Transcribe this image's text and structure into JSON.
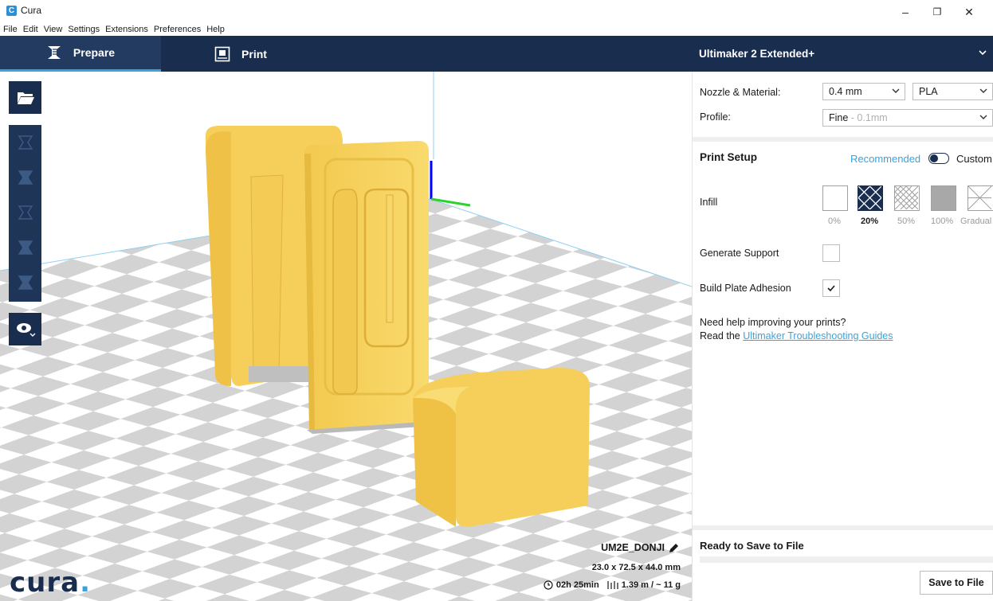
{
  "window": {
    "app_title": "Cura",
    "app_icon_letter": "C",
    "minimize": "–",
    "maximize": "❐",
    "close": "✕"
  },
  "menu": [
    "File",
    "Edit",
    "View",
    "Settings",
    "Extensions",
    "Preferences",
    "Help"
  ],
  "toolbar": {
    "tabs": [
      {
        "label": "Prepare",
        "icon": "layers-icon",
        "active": true
      },
      {
        "label": "Print",
        "icon": "monitor-icon",
        "active": false
      }
    ],
    "machine_name": "Ultimaker 2 Extended+"
  },
  "left_tools": [
    "open-file-icon",
    "move-icon",
    "scale-icon",
    "rotate-icon",
    "mirror-icon",
    "per-model-settings-icon",
    "view-mode-icon"
  ],
  "job": {
    "name": "UM2E_DONJI",
    "dimensions": "23.0 x 72.5 x 44.0 mm",
    "time": "02h 25min",
    "material": "1.39 m / ~ 11 g"
  },
  "logo": {
    "text": "cura",
    "dot": "."
  },
  "sidebar": {
    "nozzle_label": "Nozzle & Material:",
    "nozzle_value": "0.4 mm",
    "material_value": "PLA",
    "profile_label": "Profile:",
    "profile_value": "Fine",
    "profile_sub": " - 0.1mm",
    "setup_title": "Print Setup",
    "mode_recommended": "Recommended",
    "mode_custom": "Custom",
    "infill_label": "Infill",
    "infill_options": [
      {
        "label": "0%",
        "selected": false
      },
      {
        "label": "20%",
        "selected": true
      },
      {
        "label": "50%",
        "selected": false
      },
      {
        "label": "100%",
        "selected": false
      },
      {
        "label": "Gradual",
        "selected": false
      }
    ],
    "support_label": "Generate Support",
    "support_checked": false,
    "adhesion_label": "Build Plate Adhesion",
    "adhesion_checked": true,
    "help_line1": "Need help improving your prints?",
    "help_line2_prefix": "Read the ",
    "help_link": "Ultimaker Troubleshooting Guides",
    "ready_title": "Ready to Save to File",
    "save_button": "Save to File"
  },
  "colors": {
    "dark_blue": "#192d4f",
    "accent": "#3ba3dc",
    "model_yellow": "#f7d363"
  }
}
